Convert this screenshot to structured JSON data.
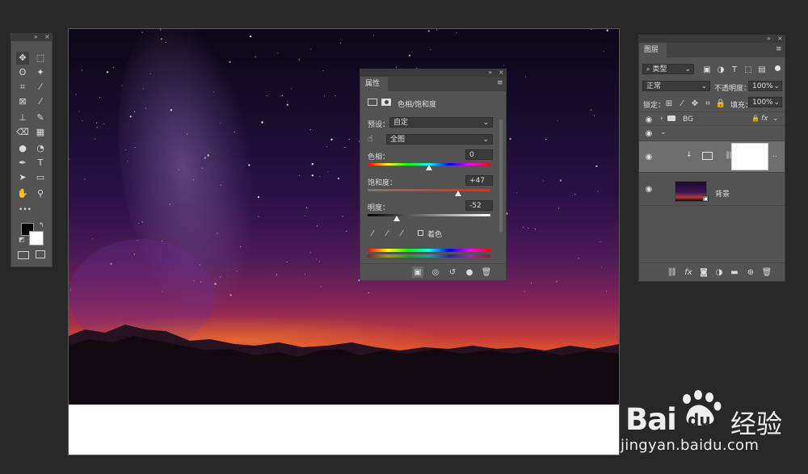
{
  "tools": {
    "icons": [
      "move-icon",
      "marquee-icon",
      "lasso-icon",
      "magic-wand-icon",
      "crop-icon",
      "eyedropper-icon",
      "frame-icon",
      "brush-icon",
      "stamp-icon",
      "history-brush-icon",
      "eraser-icon",
      "gradient-icon",
      "blur-icon",
      "dodge-icon",
      "pen-icon",
      "type-icon",
      "path-select-icon",
      "rectangle-icon",
      "hand-icon",
      "zoom-icon",
      "more-tools-icon",
      "color-swatch-icon",
      "quick-mask-icon",
      "screen-mode-icon"
    ],
    "glyphs": [
      "✥",
      "⬚",
      "ʘ",
      "✦",
      "⌗",
      "⁄",
      "⊠",
      "⁄",
      "⊥",
      "✎",
      "⌫",
      "▦",
      "●",
      "◔",
      "✒",
      "T",
      "➤",
      "▭",
      "✋",
      "⚲",
      "•••"
    ],
    "foreground": "#000000",
    "background": "#ffffff"
  },
  "properties": {
    "tab": "属性",
    "adjustment_title": "色相/饱和度",
    "preset_label": "预设：",
    "preset_value": "自定",
    "channel_value": "全图",
    "hue_label": "色相：",
    "hue_value": "0",
    "hue_fraction": 0.5,
    "saturation_label": "饱和度：",
    "saturation_value": "+47",
    "saturation_fraction": 0.735,
    "lightness_label": "明度：",
    "lightness_value": "-52",
    "lightness_fraction": 0.24,
    "colorize_label": "着色",
    "colorize_checked": false
  },
  "layers": {
    "tab": "图层",
    "filter_label": "类型",
    "blend_mode": "正常",
    "opacity_label": "不透明度：",
    "opacity_value": "100%",
    "lock_label": "锁定：",
    "fill_label": "填充：",
    "fill_value": "100%",
    "group_name": "BG",
    "background_layer_name": "背景"
  },
  "watermark": {
    "logo_text_a": "Bai",
    "logo_text_b": "du",
    "logo_cn": "经验",
    "url": "jingyan.baidu.com"
  }
}
